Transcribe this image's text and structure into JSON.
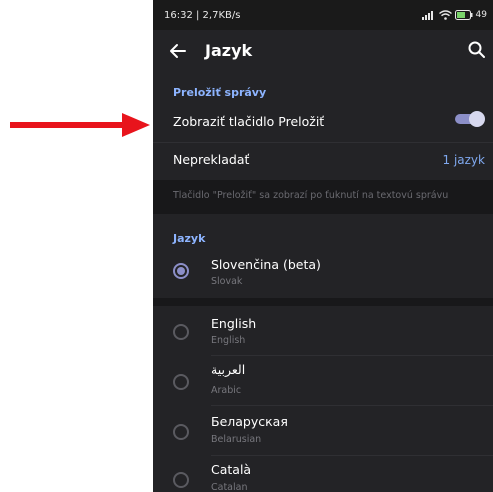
{
  "status_bar": {
    "time_rate": "16:32 | 2,7KB/s",
    "battery": "49"
  },
  "header": {
    "title": "Jazyk"
  },
  "translate_section": {
    "title": "Preložiť správy",
    "show_button_label": "Zobraziť tlačidlo Preložiť",
    "show_button_on": true,
    "do_not_translate_label": "Neprekladať",
    "do_not_translate_value": "1 jazyk",
    "hint": "Tlačidlo \"Preložiť\" sa zobrazí po ťuknutí na textovú správu"
  },
  "language_section": {
    "title": "Jazyk",
    "selected": {
      "name": "Slovenčina (beta)",
      "native": "Slovak"
    },
    "others": [
      {
        "name": "English",
        "native": "English"
      },
      {
        "name": "العربية",
        "native": "Arabic"
      },
      {
        "name": "Беларуская",
        "native": "Belarusian"
      },
      {
        "name": "Català",
        "native": "Catalan"
      }
    ]
  },
  "colors": {
    "accent": "#8c8fc8",
    "section_title": "#8db4ff",
    "annotation_arrow": "#e8141c"
  },
  "icons": [
    "back-arrow-icon",
    "search-icon",
    "signal-icon",
    "wifi-icon",
    "battery-icon",
    "red-annotation-arrow"
  ]
}
